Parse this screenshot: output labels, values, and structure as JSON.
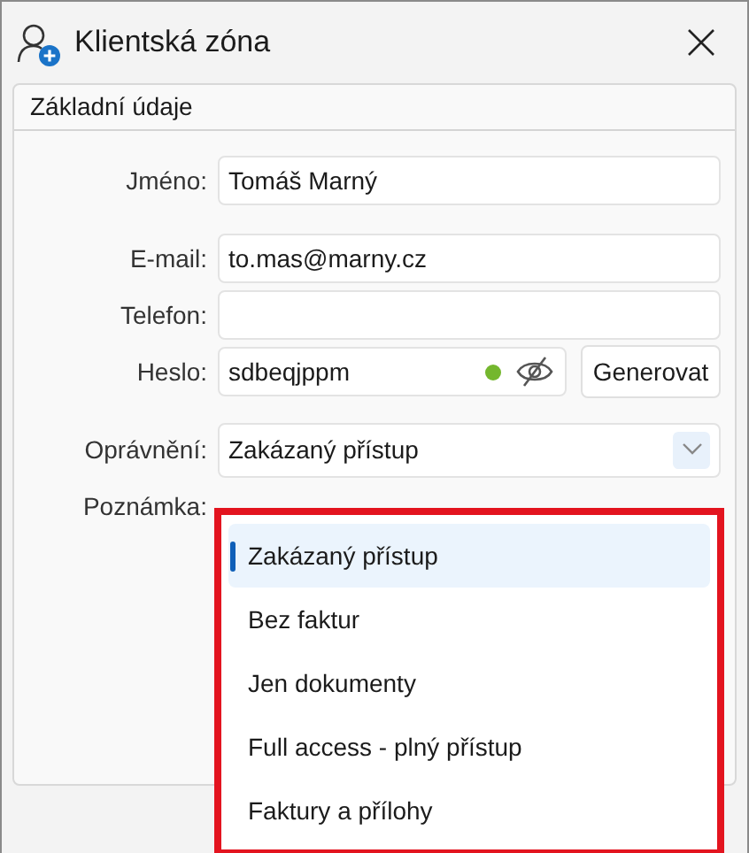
{
  "window": {
    "title": "Klientská zóna"
  },
  "tabs": [
    {
      "label": "Základní údaje",
      "selected": true
    }
  ],
  "field_groups": [
    {
      "fields": [
        {
          "kind": "text",
          "label": "Jméno:",
          "value": "Tomáš Marný"
        }
      ]
    },
    {
      "fields": [
        {
          "kind": "text",
          "label": "E-mail:",
          "value": "to.mas@marny.cz"
        },
        {
          "kind": "text",
          "label": "Telefon:"
        },
        {
          "kind": "password",
          "label": "Heslo:",
          "value": "sdbeqjppm",
          "strength_ok": true,
          "visible": false,
          "button": "Generovat"
        }
      ]
    },
    {
      "fields": [
        {
          "kind": "select",
          "label": "Oprávnění:",
          "value": "Zakázaný přístup"
        },
        {
          "kind": "note",
          "label": "Poznámka:"
        }
      ]
    }
  ],
  "dropdown": {
    "highlighted": true,
    "options": [
      {
        "label": "Zakázaný přístup",
        "selected": true
      },
      {
        "label": "Bez faktur",
        "selected": false
      },
      {
        "label": "Jen dokumenty",
        "selected": false
      },
      {
        "label": "Full access - plný přístup",
        "selected": false
      },
      {
        "label": "Faktury a přílohy",
        "selected": false
      }
    ]
  }
}
